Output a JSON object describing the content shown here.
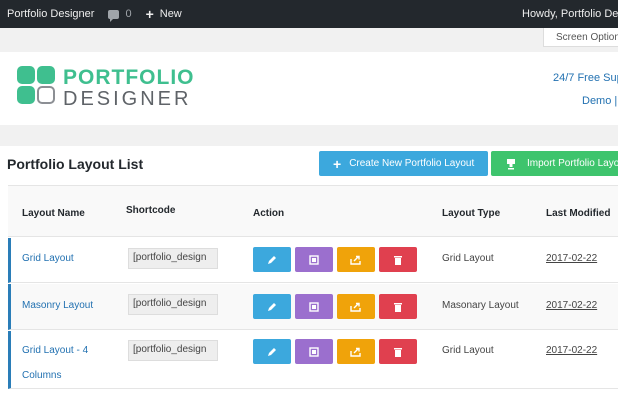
{
  "admin_bar": {
    "site_name": "Portfolio Designer",
    "comments_count": "0",
    "new_label": "New",
    "howdy": "Howdy, Portfolio Desi"
  },
  "screen_options": "Screen Option",
  "header": {
    "brand_top": "PORTFOLIO",
    "brand_bottom": "DESIGNER",
    "support": "24/7 Free Sup",
    "demo": "Demo |"
  },
  "list": {
    "title": "Portfolio Layout List",
    "create_button": "Create New Portfolio Layout",
    "import_button": "Import Portfolio Layo",
    "columns": [
      "Layout Name",
      "Shortcode",
      "Action",
      "Layout Type",
      "Last Modified"
    ],
    "rows": [
      {
        "name": "Grid Layout",
        "shortcode": "[portfolio_design",
        "type": "Grid Layout",
        "date": "2017-02-22"
      },
      {
        "name": "Masonry Layout",
        "shortcode": "[portfolio_design",
        "type": "Masonary Layout",
        "date": "2017-02-22"
      },
      {
        "name_line1": "Grid Layout - 4",
        "name_line2": "Columns",
        "shortcode": "[portfolio_design",
        "type": "Grid Layout",
        "date": "2017-02-22"
      }
    ]
  },
  "colors": {
    "brand_green": "#3fbf8f",
    "edit": "#3ca8dd",
    "copy": "#9b6fce",
    "export": "#f0a30a",
    "delete": "#e0404f",
    "import": "#3ec46d"
  }
}
